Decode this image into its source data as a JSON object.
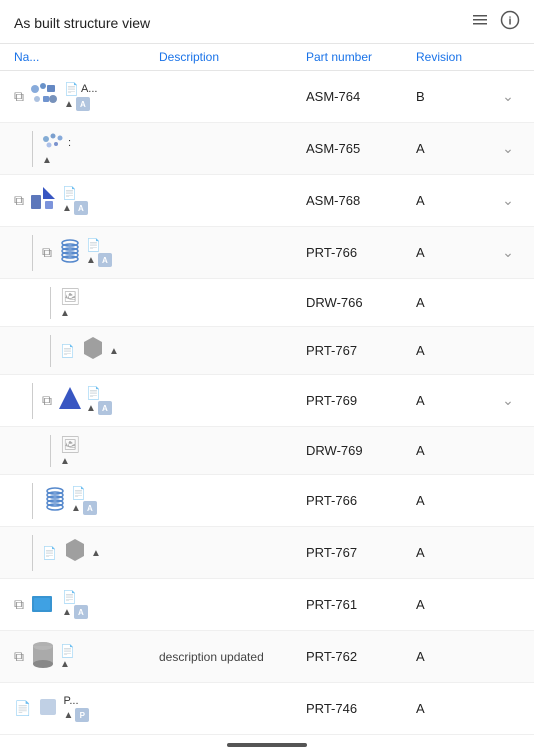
{
  "header": {
    "title": "As built structure view"
  },
  "columns": {
    "name": "Na...",
    "description": "Description",
    "part_number": "Part number",
    "revision": "Revision"
  },
  "rows": [
    {
      "id": 1,
      "indent": 0,
      "has_expand": true,
      "name_short": "A...",
      "description": "",
      "part_number": "ASM-764",
      "revision": "B",
      "has_chevron": true,
      "icon_type": "assembly_multi",
      "badge": "A"
    },
    {
      "id": 2,
      "indent": 1,
      "has_expand": false,
      "name_short": ":",
      "description": "",
      "part_number": "ASM-765",
      "revision": "A",
      "has_chevron": true,
      "icon_type": "dots",
      "badge": ""
    },
    {
      "id": 3,
      "indent": 0,
      "has_expand": true,
      "name_short": "",
      "description": "",
      "part_number": "ASM-768",
      "revision": "A",
      "has_chevron": true,
      "icon_type": "assembly_blue",
      "badge": "A"
    },
    {
      "id": 4,
      "indent": 1,
      "has_expand": true,
      "name_short": "",
      "description": "",
      "part_number": "PRT-766",
      "revision": "A",
      "has_chevron": true,
      "icon_type": "spring",
      "badge": "A"
    },
    {
      "id": 5,
      "indent": 2,
      "has_expand": false,
      "name_short": "",
      "description": "",
      "part_number": "DRW-766",
      "revision": "A",
      "has_chevron": false,
      "icon_type": "drawing",
      "badge": ""
    },
    {
      "id": 6,
      "indent": 2,
      "has_expand": false,
      "name_short": "",
      "description": "",
      "part_number": "PRT-767",
      "revision": "A",
      "has_chevron": false,
      "icon_type": "hex",
      "badge": ""
    },
    {
      "id": 7,
      "indent": 1,
      "has_expand": true,
      "name_short": "",
      "description": "",
      "part_number": "PRT-769",
      "revision": "A",
      "has_chevron": true,
      "icon_type": "triangle_blue",
      "badge": "A"
    },
    {
      "id": 8,
      "indent": 2,
      "has_expand": false,
      "name_short": "",
      "description": "",
      "part_number": "DRW-769",
      "revision": "A",
      "has_chevron": false,
      "icon_type": "drawing",
      "badge": ""
    },
    {
      "id": 9,
      "indent": 1,
      "has_expand": false,
      "name_short": "",
      "description": "",
      "part_number": "PRT-766",
      "revision": "A",
      "has_chevron": false,
      "icon_type": "spring2",
      "badge": "A"
    },
    {
      "id": 10,
      "indent": 1,
      "has_expand": false,
      "name_short": "",
      "description": "",
      "part_number": "PRT-767",
      "revision": "A",
      "has_chevron": false,
      "icon_type": "hex2",
      "badge": ""
    },
    {
      "id": 11,
      "indent": 0,
      "has_expand": true,
      "name_short": "",
      "description": "",
      "part_number": "PRT-761",
      "revision": "A",
      "has_chevron": false,
      "icon_type": "blue_box",
      "badge": "A"
    },
    {
      "id": 12,
      "indent": 0,
      "has_expand": true,
      "name_short": "",
      "description": "description updated",
      "part_number": "PRT-762",
      "revision": "A",
      "has_chevron": false,
      "icon_type": "cylinder",
      "badge": ""
    },
    {
      "id": 13,
      "indent": 0,
      "has_expand": false,
      "name_short": "P...",
      "description": "",
      "part_number": "PRT-746",
      "revision": "A",
      "has_chevron": false,
      "icon_type": "small_part",
      "badge": "P"
    }
  ],
  "bottom_indicator": "─────"
}
